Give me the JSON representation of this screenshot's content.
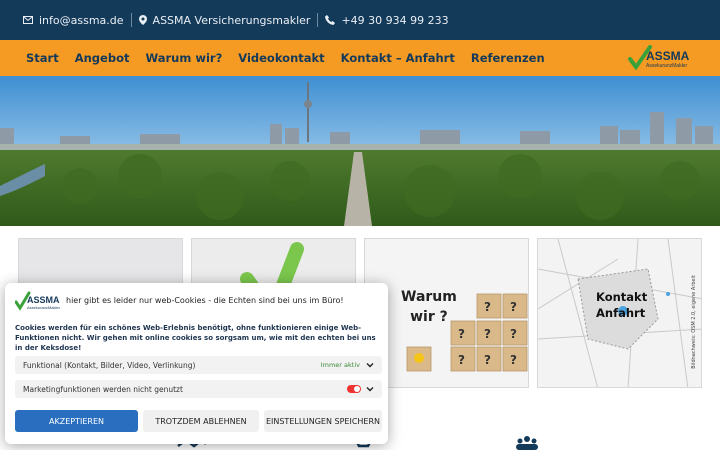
{
  "topbar": {
    "email": "info@assma.de",
    "company": "ASSMA Versicherungsmakler",
    "phone": "+49 30 934 99 233"
  },
  "nav": {
    "items": [
      "Start",
      "Angebot",
      "Warum wir?",
      "Videokontakt",
      "Kontakt – Anfahrt",
      "Referenzen"
    ]
  },
  "logo": {
    "name": "ASSMA",
    "sub": "AssekuranzMakler"
  },
  "cards": {
    "warum_line1": "Warum",
    "warum_line2": "wir ?",
    "map_line1": "Kontakt",
    "map_line2": "Anfahrt",
    "map_side": "Bildnachweis: OSM 2.0, eigene Arbeit"
  },
  "consent": {
    "logo_name": "ASSMA",
    "logo_sub": "AssekuranzMakler",
    "headline": "hier gibt es leider nur web-Cookies - die Echten sind bei uns im Büro!",
    "description": "Cookies werden für ein schönes Web-Erlebnis benötigt, ohne funktionieren einige Web-Funktionen nicht. Wir gehen mit online cookies so sorgsam um, wie mit den echten bei uns in der Keksdose!",
    "row1_label": "Funktional (Kontakt, Bilder, Video, Verlinkung)",
    "row1_status": "Immer aktiv",
    "row2_label": "Marketingfunktionen werden nicht genutzt",
    "accept": "AKZEPTIEREN",
    "deny": "TROTZDEM ABLEHNEN",
    "save": "EINSTELLUNGEN SPEICHERN"
  },
  "colors": {
    "topbar": "#143a5a",
    "nav": "#f59a23",
    "accept": "#2a6fbf",
    "logo_green": "#3aa13a"
  }
}
